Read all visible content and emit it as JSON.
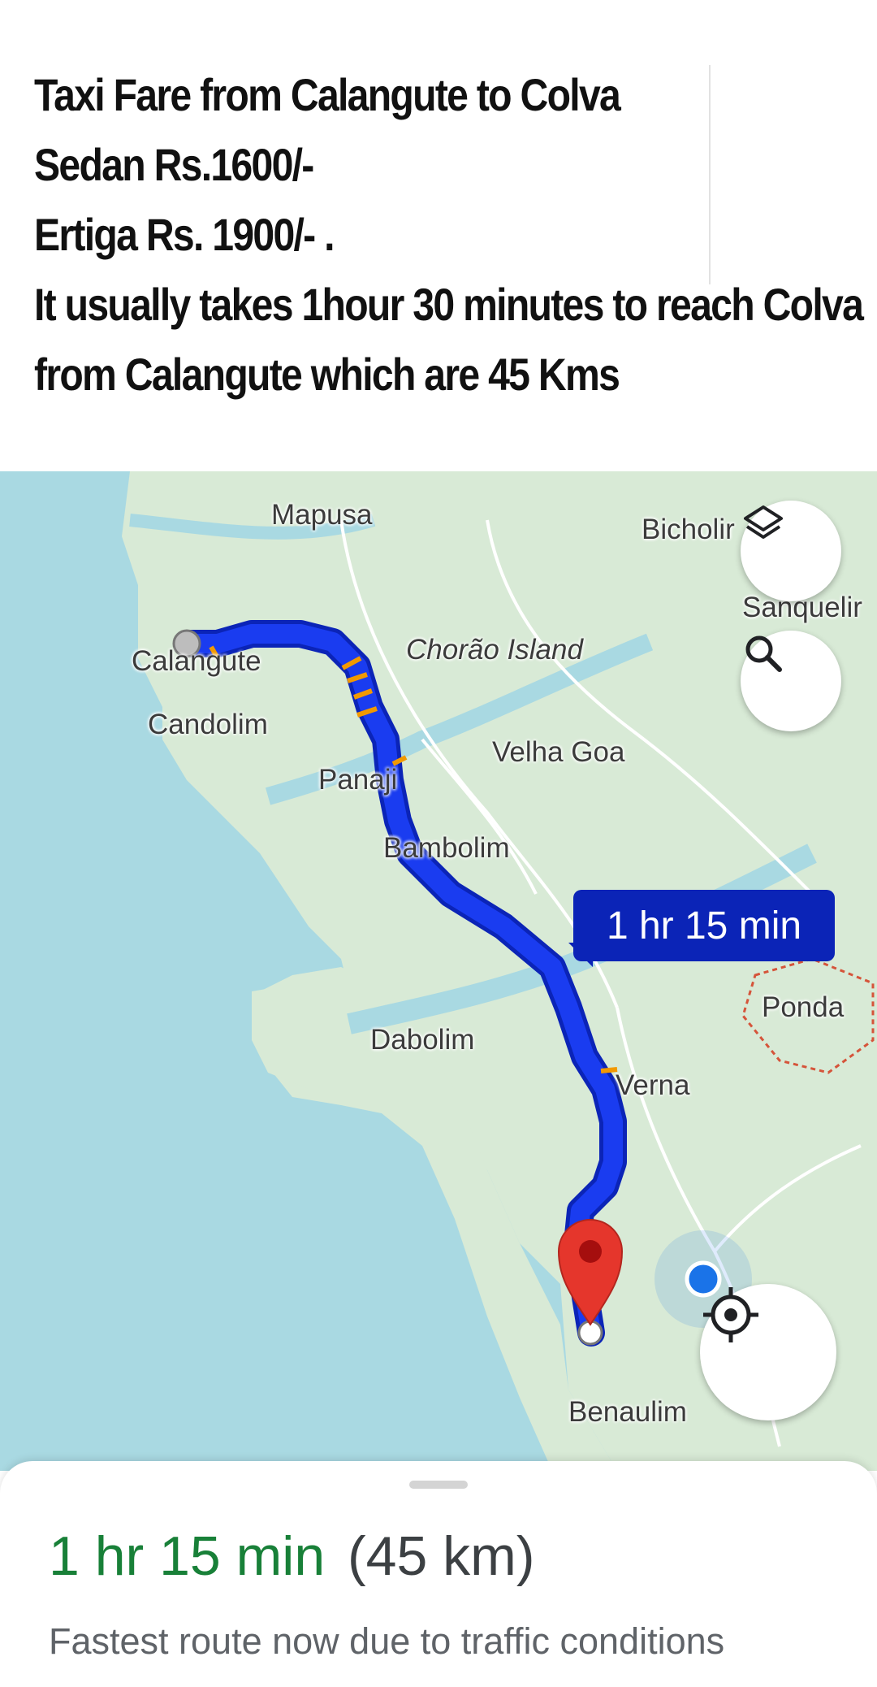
{
  "header": {
    "lines": [
      "Taxi Fare from Calangute to Colva",
      "Sedan Rs.1600/-",
      "Ertiga Rs. 1900/- .",
      "It usually takes 1hour 30 minutes to reach Colva",
      "from  Calangute which are 45 Kms"
    ]
  },
  "map": {
    "labels": {
      "mapusa": "Mapusa",
      "bicholim": "Bicholir",
      "sanquelim": "Sanquelir",
      "calangute": "Calangute",
      "chorao": "Chorão Island",
      "candolim": "Candolim",
      "velha_goa": "Velha Goa",
      "panaji": "Panaji",
      "bambolim": "Bambolim",
      "ponda": "Ponda",
      "dabolim": "Dabolim",
      "verna": "Verna",
      "benaulim": "Benaulim"
    },
    "route_callout": "1 hr 15 min",
    "buttons": {
      "layers_icon": "layers-icon",
      "search_icon": "search-icon",
      "locate_icon": "my-location-icon"
    },
    "colors": {
      "water": "#a9d9e2",
      "land": "#d8ead6",
      "route": "#1a3cf0",
      "route_border": "#0b24b7",
      "traffic": "#f29900",
      "destination_pin": "#e5362c",
      "my_location": "#1a73e8"
    }
  },
  "sheet": {
    "time": "1 hr 15 min",
    "distance": "(45 km)",
    "note": "Fastest route now due to traffic conditions"
  }
}
